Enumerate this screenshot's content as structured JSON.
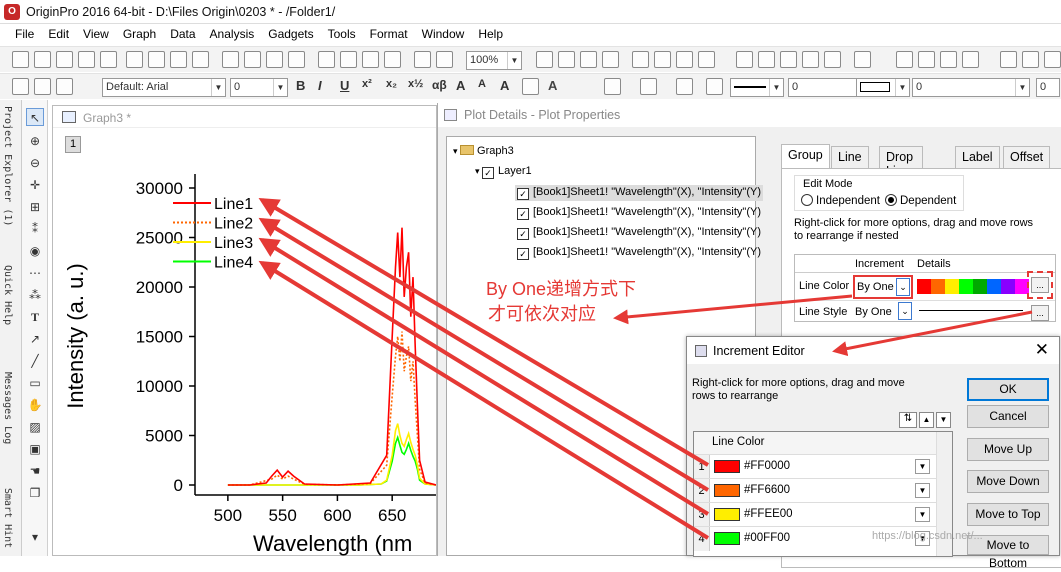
{
  "window": {
    "title": "OriginPro 2016 64-bit - D:\\Files Origin\\0203 * - /Folder1/"
  },
  "menu": [
    "File",
    "Edit",
    "View",
    "Graph",
    "Data",
    "Analysis",
    "Gadgets",
    "Tools",
    "Format",
    "Window",
    "Help"
  ],
  "toolbar": {
    "zoom": "100%",
    "font": "Default: Arial",
    "font_size": "0",
    "size_b": "0",
    "size_c": "0",
    "size_d": "0"
  },
  "side_panels": [
    "Project Explorer (1)",
    "Quick Help",
    "Messages Log",
    "Smart Hint"
  ],
  "graph_window": {
    "title": "Graph3 *",
    "layer_label": "1"
  },
  "chart_data": {
    "type": "line",
    "xlabel": "Wavelength (nm",
    "ylabel": "Intensity (a. u.)",
    "xlim": [
      470,
      690
    ],
    "ylim": [
      -1500,
      31000
    ],
    "x_ticks": [
      "500",
      "550",
      "600",
      "650"
    ],
    "y_ticks": [
      "0",
      "5000",
      "10000",
      "15000",
      "20000",
      "25000",
      "30000"
    ],
    "legend_position": "top-left",
    "series": [
      {
        "name": "Line1",
        "color": "#FF0000",
        "style": "solid",
        "x": [
          500,
          520,
          535,
          540,
          545,
          550,
          555,
          560,
          570,
          600,
          630,
          645,
          650,
          653,
          655,
          657,
          659,
          661,
          663,
          665,
          667,
          669,
          671,
          673,
          675,
          680,
          690
        ],
        "y": [
          0,
          0,
          200,
          900,
          1500,
          800,
          1400,
          900,
          100,
          0,
          200,
          3000,
          15000,
          22000,
          25500,
          21000,
          26000,
          19000,
          22000,
          23500,
          17000,
          21000,
          14000,
          8000,
          2500,
          300,
          0
        ]
      },
      {
        "name": "Line2",
        "color": "#FF6600",
        "style": "dotted",
        "x": [
          500,
          520,
          540,
          545,
          550,
          555,
          560,
          570,
          600,
          630,
          645,
          650,
          653,
          655,
          657,
          659,
          661,
          663,
          665,
          667,
          669,
          671,
          673,
          675,
          680,
          690
        ],
        "y": [
          0,
          0,
          600,
          1000,
          600,
          900,
          600,
          80,
          0,
          150,
          2000,
          9000,
          13000,
          15000,
          12500,
          15500,
          11500,
          13000,
          14000,
          10500,
          12500,
          8500,
          5000,
          1600,
          200,
          0
        ]
      },
      {
        "name": "Line3",
        "color": "#FFEE00",
        "style": "solid",
        "x": [
          500,
          620,
          640,
          645,
          650,
          653,
          655,
          657,
          659,
          661,
          663,
          665,
          667,
          669,
          671,
          673,
          675,
          680,
          690
        ],
        "y": [
          0,
          0,
          100,
          500,
          3000,
          5500,
          6200,
          5000,
          4200,
          3900,
          4600,
          5200,
          4300,
          3600,
          3000,
          2000,
          700,
          100,
          0
        ]
      },
      {
        "name": "Line4",
        "color": "#00FF00",
        "style": "solid",
        "x": [
          500,
          620,
          640,
          645,
          650,
          653,
          655,
          657,
          659,
          661,
          663,
          665,
          667,
          669,
          671,
          673,
          675,
          680,
          690
        ],
        "y": [
          0,
          0,
          100,
          400,
          2400,
          4200,
          4800,
          4000,
          3300,
          3100,
          3600,
          4200,
          3500,
          2900,
          2400,
          1600,
          500,
          100,
          0
        ]
      }
    ]
  },
  "plot_details": {
    "title": "Plot Details - Plot Properties",
    "tree": {
      "root": "Graph3",
      "layer": "Layer1",
      "plots": [
        "[Book1]Sheet1! \"Wavelength\"(X), \"Intensity\"(Y)",
        "[Book1]Sheet1! \"Wavelength\"(X), \"Intensity\"(Y)",
        "[Book1]Sheet1! \"Wavelength\"(X), \"Intensity\"(Y)",
        "[Book1]Sheet1! \"Wavelength\"(X), \"Intensity\"(Y)"
      ]
    },
    "tabs": [
      "Group",
      "Line",
      "Drop Lines",
      "Label",
      "Offset"
    ],
    "edge_text": "Gr",
    "edit_mode_label": "Edit Mode",
    "edit_mode_options": [
      "Independent",
      "Dependent"
    ],
    "edit_mode_selected": "Dependent",
    "hint": "Right-click for more options, drag and move rows to  rearrange if nested",
    "table_headers": {
      "increment": "Increment",
      "details": "Details"
    },
    "rows": [
      {
        "label": "Line Color",
        "increment": "By One"
      },
      {
        "label": "Line Style",
        "increment": "By One"
      }
    ],
    "ellipsis": "..."
  },
  "increment_editor": {
    "title": "Increment Editor",
    "hint": "Right-click for more options, drag and move rows to  rearrange",
    "column_header": "Line Color",
    "rows": [
      {
        "num": "1",
        "color": "#FF0000",
        "hex": "#FF0000"
      },
      {
        "num": "2",
        "color": "#FF6600",
        "hex": "#FF6600"
      },
      {
        "num": "3",
        "color": "#FFEE00",
        "hex": "#FFEE00"
      },
      {
        "num": "4",
        "color": "#00FF00",
        "hex": "#00FF00"
      }
    ],
    "buttons": {
      "ok": "OK",
      "cancel": "Cancel",
      "move_up": "Move Up",
      "move_down": "Move Down",
      "move_top": "Move to Top",
      "move_bottom": "Move to Bottom"
    },
    "close": "✕"
  },
  "annotation": {
    "line1": "By One递增方式下",
    "line2": "才可依次对应",
    "color": "#E53935"
  },
  "watermark": "https://blog.csdn.net/..."
}
